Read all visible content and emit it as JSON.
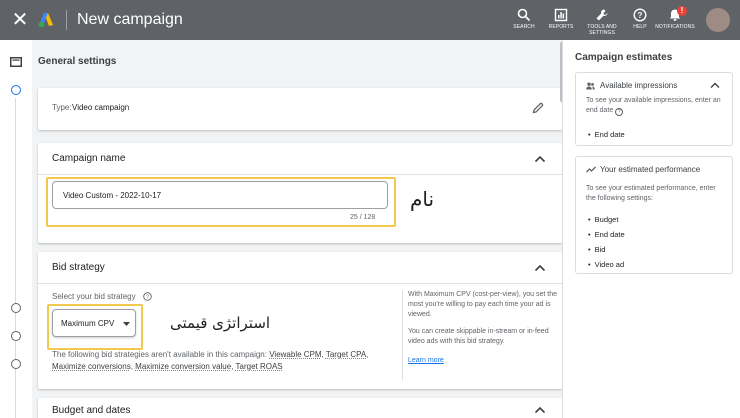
{
  "topbar": {
    "close_icon": "close-icon",
    "title": "New campaign",
    "tools": [
      {
        "label": "SEARCH",
        "icon": "search-icon"
      },
      {
        "label": "REPORTS",
        "icon": "reports-icon"
      },
      {
        "label": "TOOLS AND SETTINGS",
        "icon": "wrench-icon"
      },
      {
        "label": "HELP",
        "icon": "help-icon"
      },
      {
        "label": "NOTIFICATIONS",
        "icon": "bell-icon",
        "badge": "!"
      }
    ]
  },
  "main": {
    "section_title": "General settings",
    "type_card": {
      "label": "Type:",
      "value": "Video campaign",
      "icon": "edit-pencil-icon"
    },
    "campaign_name": {
      "heading": "Campaign name",
      "value": "Video Custom - 2022-10-17",
      "counter": "25 / 128",
      "annotation": "نام"
    },
    "bid_strategy": {
      "heading": "Bid strategy",
      "select_label": "Select your bid strategy",
      "selected": "Maximum CPV",
      "annotation": "استراتژی قیمتی",
      "unavailable_prefix": "The following bid strategies aren't available in this campaign:",
      "unavailable": [
        "Viewable CPM",
        "Target CPA",
        "Maximize conversions",
        "Maximize conversion value",
        "Target ROAS"
      ],
      "info1": "With Maximum CPV (cost-per-view), you set the most you're willing to pay each time your ad is viewed.",
      "info2": "You can create skippable in-stream or in-feed video ads with this bid strategy.",
      "learn_more": "Learn more"
    },
    "budget": {
      "heading": "Budget and dates"
    }
  },
  "right": {
    "title": "Campaign estimates",
    "impressions": {
      "heading": "Available impressions",
      "text": "To see your available impressions, enter an end date",
      "items": [
        "End date"
      ]
    },
    "performance": {
      "heading": "Your estimated performance",
      "text": "To see your estimated performance, enter the following settings:",
      "items": [
        "Budget",
        "End date",
        "Bid",
        "Video ad"
      ]
    }
  },
  "colors": {
    "topbar": "#5f6368",
    "highlight": "#f2c94c",
    "link": "#1a73e8",
    "badge": "#ea4335"
  }
}
